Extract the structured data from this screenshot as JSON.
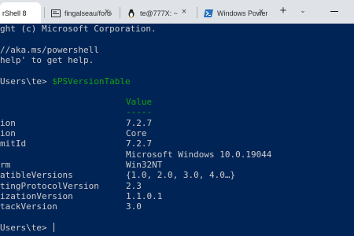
{
  "tabs": [
    {
      "title": "rShell 8",
      "close": "×"
    },
    {
      "title": "fingalseau/forder",
      "close": "×"
    },
    {
      "title": "te@777X: ~",
      "close": "×"
    },
    {
      "title": "Windows PowerS",
      "close": "×"
    }
  ],
  "tabbar": {
    "new_tab": "+",
    "dropdown": "⌄"
  },
  "terminal": {
    "copyright": "ght (c) Microsoft Corporation.",
    "url_line": "//aka.ms/powershell",
    "help_line": "help' to get help.",
    "prompt1": "Users\\te> ",
    "command": "$PSVersionTable",
    "header_value": "Value",
    "header_dashes": "-----",
    "rows": [
      {
        "name": "ion",
        "value": "7.2.7"
      },
      {
        "name": "ion",
        "value": "Core"
      },
      {
        "name": "mitId",
        "value": "7.2.7"
      },
      {
        "name": "",
        "value": "Microsoft Windows 10.0.19044"
      },
      {
        "name": "rm",
        "value": "Win32NT"
      },
      {
        "name": "atibleVersions",
        "value": "{1.0, 2.0, 3.0, 4.0…}"
      },
      {
        "name": "tingProtocolVersion",
        "value": "2.3"
      },
      {
        "name": "izationVersion",
        "value": "1.1.0.1"
      },
      {
        "name": "tackVersion",
        "value": "3.0"
      }
    ],
    "prompt2": "Users\\te> "
  },
  "colors": {
    "background": "#012456",
    "text": "#cccccc",
    "accent_green": "#13a10e"
  }
}
